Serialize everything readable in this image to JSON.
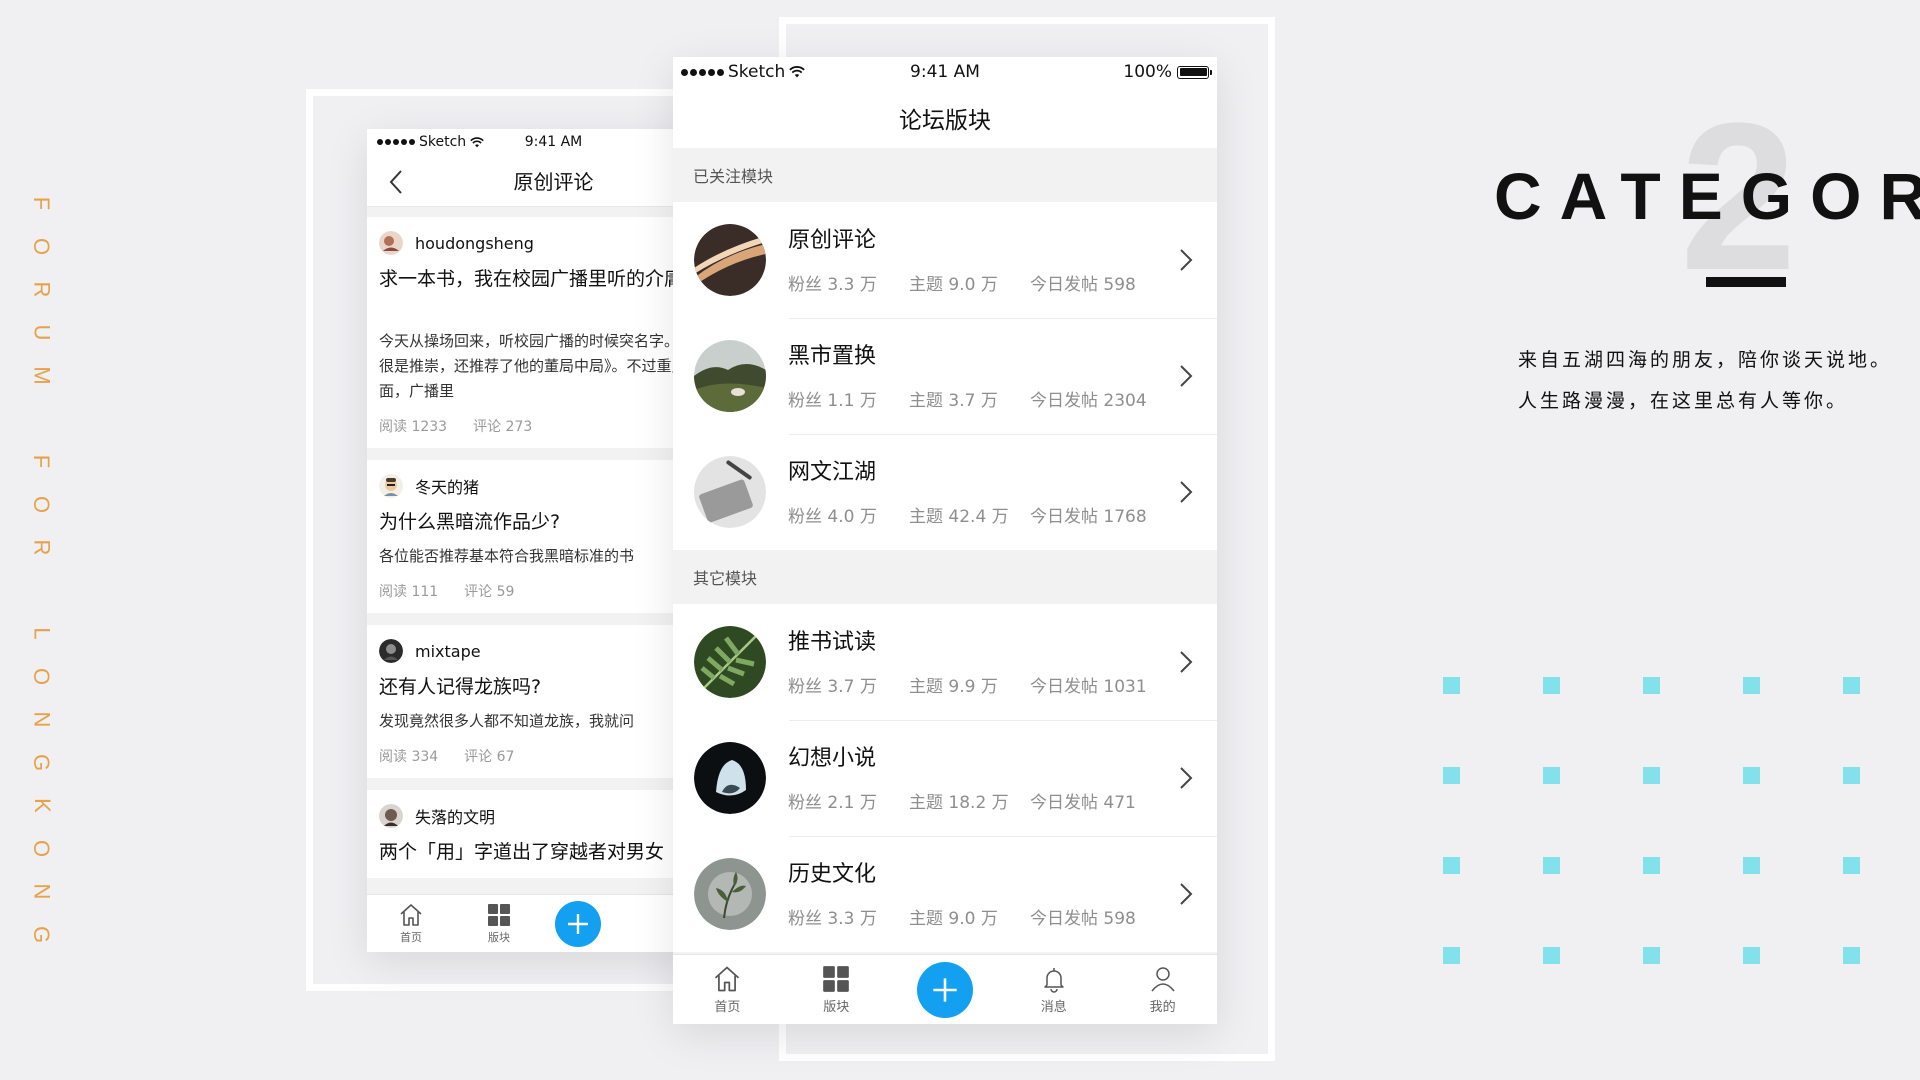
{
  "caption": [
    "F",
    "O",
    "R",
    "U",
    "M",
    " ",
    "F",
    "O",
    "R",
    " ",
    "L",
    "O",
    "N",
    "G",
    "K",
    "O",
    "N",
    "G"
  ],
  "brand": {
    "number": "2",
    "title": "CATEGORY",
    "line1": "来自五湖四海的朋友，陪你谈天说地。",
    "line2": "人生路漫漫，在这里总有人等你。",
    "accent_color": "#83e1ec",
    "caption_color": "#e6a24a"
  },
  "phone_left": {
    "status": {
      "carrier": "Sketch",
      "time": "9:41 AM"
    },
    "nav_title": "原创评论",
    "posts": [
      {
        "user": "houdongsheng",
        "title": "求一本书，我在校园广播里听的介庸）",
        "body": "今天从操场回来，听校园广播的时候突名字。对亲王很是推崇，还推荐了他的董局中局》。不过重点是后面，广播里",
        "reads": "阅读 1233",
        "comments": "评论 273"
      },
      {
        "user": "冬天的猪",
        "title": "为什么黑暗流作品少?",
        "body": "各位能否推荐基本符合我黑暗标准的书",
        "reads": "阅读 111",
        "comments": "评论 59"
      },
      {
        "user": "mixtape",
        "title": "还有人记得龙族吗?",
        "body": "发现竟然很多人都不知道龙族，我就问",
        "reads": "阅读 334",
        "comments": "评论 67"
      },
      {
        "user": "失落的文明",
        "title": "两个「用」字道出了穿越者对男女",
        "body": "",
        "reads": "",
        "comments": ""
      }
    ],
    "tabs": {
      "home": "首页",
      "board": "版块"
    }
  },
  "phone_right": {
    "status": {
      "carrier": "Sketch",
      "time": "9:41 AM",
      "battery": "100%"
    },
    "nav_title": "论坛版块",
    "section_followed": "已关注模块",
    "section_other": "其它模块",
    "followed": [
      {
        "name": "原创评论",
        "fans": "粉丝 3.3 万",
        "topics": "主题 9.0 万",
        "today": "今日发帖 598"
      },
      {
        "name": "黑市置换",
        "fans": "粉丝 1.1 万",
        "topics": "主题 3.7 万",
        "today": "今日发帖 2304"
      },
      {
        "name": "网文江湖",
        "fans": "粉丝 4.0 万",
        "topics": "主题 42.4 万",
        "today": "今日发帖 1768"
      }
    ],
    "other": [
      {
        "name": "推书试读",
        "fans": "粉丝 3.7 万",
        "topics": "主题 9.9 万",
        "today": "今日发帖 1031"
      },
      {
        "name": "幻想小说",
        "fans": "粉丝 2.1 万",
        "topics": "主题 18.2 万",
        "today": "今日发帖 471"
      },
      {
        "name": "历史文化",
        "fans": "粉丝 3.3 万",
        "topics": "主题 9.0 万",
        "today": "今日发帖 598"
      }
    ],
    "tabs": {
      "home": "首页",
      "board": "版块",
      "messages": "消息",
      "mine": "我的"
    }
  }
}
